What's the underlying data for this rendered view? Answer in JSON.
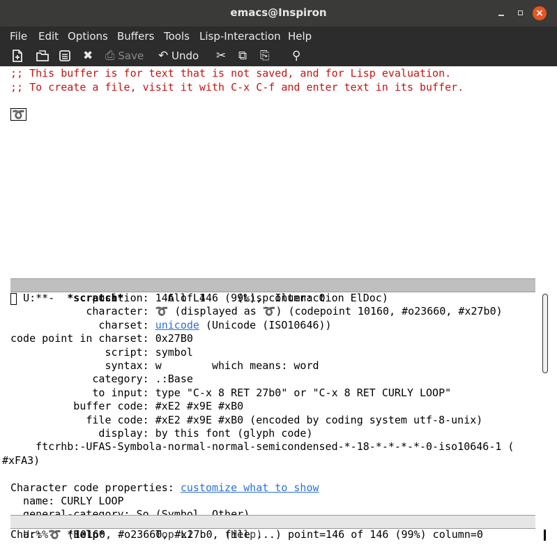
{
  "window": {
    "title": "emacs@Inspiron",
    "close_glyph": "×"
  },
  "menubar": {
    "items": [
      "File",
      "Edit",
      "Options",
      "Buffers",
      "Tools",
      "Lisp-Interaction",
      "Help"
    ]
  },
  "toolbar": {
    "new_icon": "new-file-icon",
    "open_icon": "open-folder-icon",
    "dired_icon": "dired-icon",
    "close_glyph": "✖",
    "save_label": "Save",
    "undo_label": "Undo",
    "cut_glyph": "✂",
    "copy_glyph": "⧉",
    "paste_glyph": "⎘",
    "search_glyph": "⚲"
  },
  "scratch": {
    "comment_1": ";; This buffer is for text that is not saved, and for Lisp evaluation.",
    "comment_2": ";; To create a file, visit it with C-x C-f and enter text in its buffer.",
    "char": "➰"
  },
  "modeline_top": {
    "status": "U:**-",
    "buffer": "*scratch*",
    "position": "All L4",
    "modes": "(Lisp Interaction ElDoc)"
  },
  "help": {
    "l1": "             position: 146 of 146 (99%), column: 0",
    "l2": "            character: ➰ (displayed as ➰) (codepoint 10160, #o23660, #x27b0)",
    "l3_label": "              charset: ",
    "l3_link": "unicode",
    "l3_rest": " (Unicode (ISO10646))",
    "l4": "code point in charset: 0x27B0",
    "l5": "               script: symbol",
    "l6": "               syntax: w        which means: word",
    "l7": "             category: .:Base",
    "l8": "             to input: type \"C-x 8 RET 27b0\" or \"C-x 8 RET CURLY LOOP\"",
    "l9": "          buffer code: #xE2 #x9E #xB0",
    "l10": "            file code: #xE2 #x9E #xB0 (encoded by coding system utf-8-unix)",
    "l11": "              display: by this font (glyph code)",
    "l12": "    ftcrhb:-UFAS-Symbola-normal-normal-semicondensed-*-18-*-*-*-*-0-iso10646-1 (",
    "l13": "#xFA3)",
    "l15_label": "Character code properties: ",
    "l15_link": "customize what to show",
    "l16": "  name: CURLY LOOP",
    "l17": "  general-category: So (Symbol, Other)"
  },
  "modeline_bottom": {
    "status": "U:%%-",
    "buffer": "*Help*",
    "position": "Top L1",
    "modes": "(Help)"
  },
  "echo": {
    "text": "Char: ➰ (10160, #o23660, #x27b0, file ...) point=146 of 146 (99%) column=0"
  }
}
